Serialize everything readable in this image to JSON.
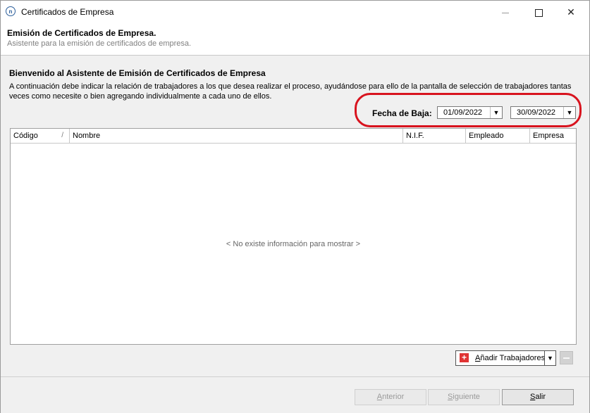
{
  "window": {
    "title": "Certificados de Empresa",
    "app_icon_text": "n"
  },
  "header": {
    "title": "Emisión de Certificados de Empresa.",
    "subtitle": "Asistente para la emisión de certificados de empresa."
  },
  "intro": {
    "title": "Bienvenido al Asistente de Emisión de Certificados de Empresa",
    "text": "A continuación debe indicar la relación de trabajadores a los que desea realizar el proceso, ayudándose para ello de la pantalla de selección de trabajadores tantas veces como necesite o bien agregando individualmente a cada uno de ellos."
  },
  "fecha": {
    "label": "Fecha de Baja:",
    "from": "01/09/2022",
    "to": "30/09/2022"
  },
  "grid": {
    "columns": [
      "Código",
      "Nombre",
      "N.I.F.",
      "Empleado",
      "Empresa"
    ],
    "sort_indicator": "/",
    "empty_message": "< No existe información para mostrar >",
    "rows": []
  },
  "actions": {
    "add_label_rest": "ñadir Trabajadores",
    "add_label_key": "A"
  },
  "footer": {
    "prev_key": "A",
    "prev_rest": "nterior",
    "next_key": "S",
    "next_rest": "iguiente",
    "exit_key": "S",
    "exit_rest": "alir"
  },
  "colors": {
    "highlight": "#d8131e",
    "add_icon": "#e03434"
  }
}
